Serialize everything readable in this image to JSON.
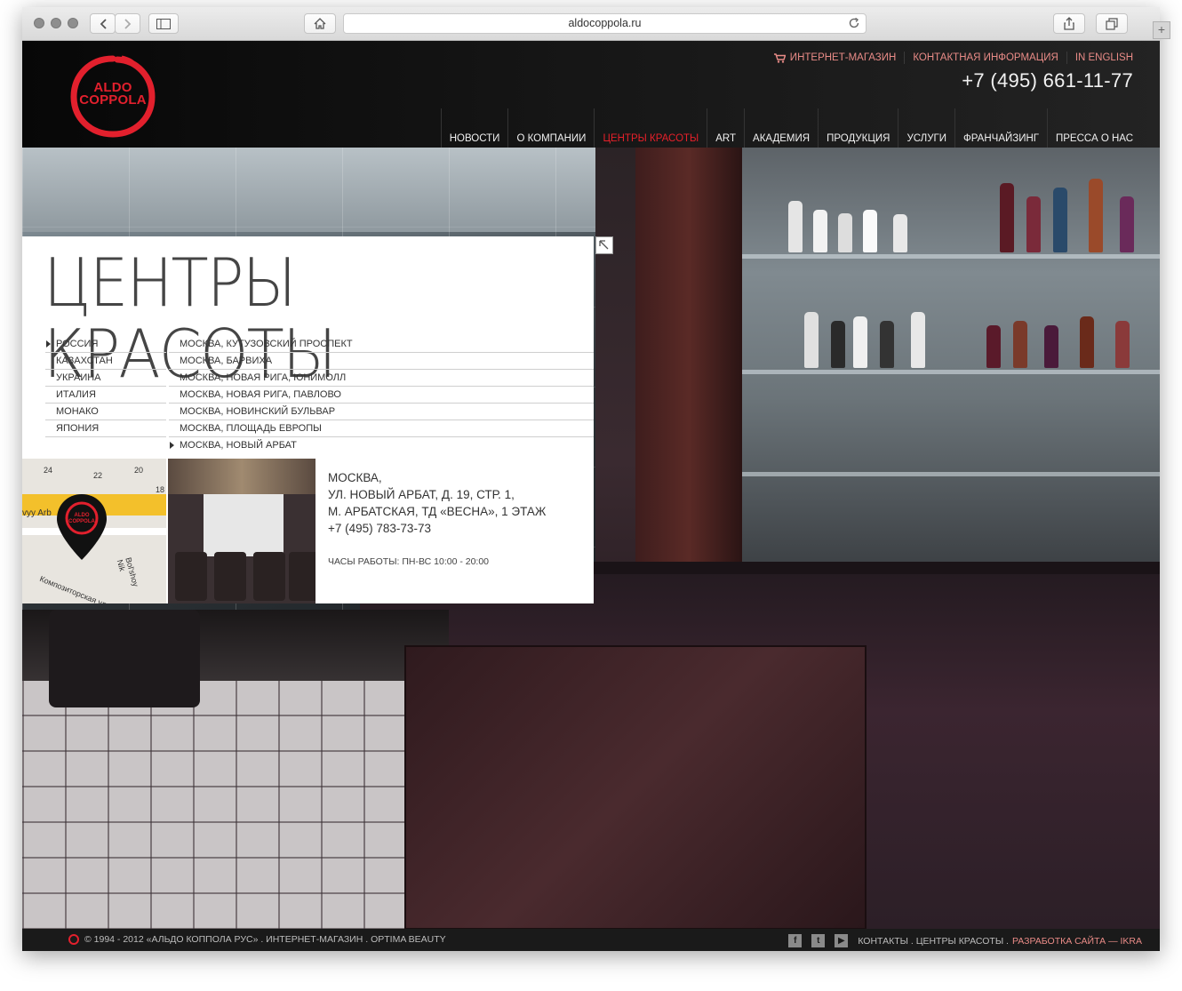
{
  "browser": {
    "url": "aldocoppola.ru"
  },
  "header": {
    "logo_line1": "ALDO",
    "logo_line2": "COPPOLA",
    "top_links": [
      "ИНТЕРНЕТ-МАГАЗИН",
      "КОНТАКТНАЯ ИНФОРМАЦИЯ",
      "IN ENGLISH"
    ],
    "phone": "+7 (495) 661-11-77",
    "nav": [
      "НОВОСТИ",
      "О КОМПАНИИ",
      "ЦЕНТРЫ КРАСОТЫ",
      "ART",
      "АКАДЕМИЯ",
      "ПРОДУКЦИЯ",
      "УСЛУГИ",
      "ФРАНЧАЙЗИНГ",
      "ПРЕССА О НАС"
    ],
    "nav_active": "ЦЕНТРЫ КРАСОТЫ"
  },
  "section": {
    "title": "ЦЕНТРЫ КРАСОТЫ",
    "countries": [
      "РОССИЯ",
      "КАЗАХСТАН",
      "УКРАИНА",
      "ИТАЛИЯ",
      "МОНАКО",
      "ЯПОНИЯ"
    ],
    "selected_country": "РОССИЯ",
    "cities": [
      "МОСКВА, КУТУЗОВСКИЙ ПРОСПЕКТ",
      "МОСКВА, БАРВИХА",
      "МОСКВА, НОВАЯ РИГА, ЮНИМОЛЛ",
      "МОСКВА, НОВАЯ РИГА, ПАВЛОВО",
      "МОСКВА, НОВИНСКИЙ БУЛЬВАР",
      "МОСКВА, ПЛОЩАДЬ ЕВРОПЫ",
      "МОСКВА, НОВЫЙ АРБАТ"
    ],
    "selected_city": "МОСКВА, НОВЫЙ АРБАТ"
  },
  "salon": {
    "city": "МОСКВА,",
    "street": "УЛ. НОВЫЙ АРБАТ, Д. 19, СТР. 1,",
    "metro": "М. АРБАТСКАЯ, ТД «ВЕСНА», 1 ЭТАЖ",
    "phone": "+7 (495) 783-73-73",
    "hours": "ЧАСЫ РАБОТЫ: ПН-ВС 10:00 - 20:00"
  },
  "map": {
    "labels": [
      "24",
      "22",
      "20",
      "18",
      "vyy Arb",
      "Bol'shoy Nik",
      "Композиторская ул."
    ]
  },
  "footer": {
    "copyright": "© 1994 - 2012 «АЛЬДО КОППОЛА РУС» . ИНТЕРНЕТ-МАГАЗИН . OPTIMA BEAUTY",
    "links": "КОНТАКТЫ . ЦЕНТРЫ КРАСОТЫ .",
    "dev": "РАЗРАБОТКА САЙТА — IKRA"
  },
  "colors": {
    "accent": "#e2202d",
    "link_pink": "#e98b87",
    "header_bg": "#151515"
  },
  "icons": [
    "home-icon",
    "reload-icon",
    "share-icon",
    "tabs-icon",
    "cart-icon",
    "facebook-icon",
    "twitter-icon",
    "youtube-icon",
    "map-pin-icon",
    "expand-icon"
  ]
}
